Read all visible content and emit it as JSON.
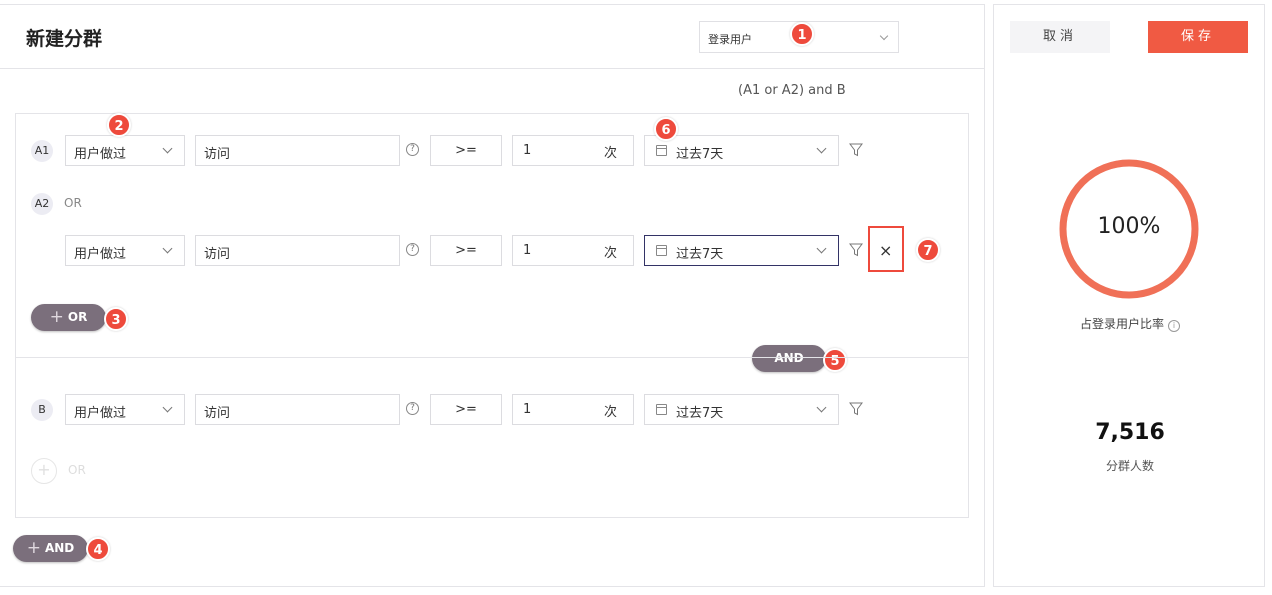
{
  "header": {
    "title": "新建分群",
    "user_type_select": "登录用户",
    "formula": "(A1 or A2) and B"
  },
  "rows": {
    "a1": {
      "badge": "A1",
      "action": "用户做过",
      "event": "访问",
      "operator": ">=",
      "count": "1",
      "unit": "次",
      "date_range": "过去7天"
    },
    "a2": {
      "badge": "A2",
      "connector": "OR",
      "action": "用户做过",
      "event": "访问",
      "operator": ">=",
      "count": "1",
      "unit": "次",
      "date_range": "过去7天"
    },
    "b": {
      "badge": "B",
      "action": "用户做过",
      "event": "访问",
      "operator": ">=",
      "count": "1",
      "unit": "次",
      "date_range": "过去7天"
    }
  },
  "buttons": {
    "add_or": "OR",
    "and_connector": "AND",
    "add_or_disabled": "OR",
    "add_and": "AND",
    "cancel": "取消",
    "save": "保存"
  },
  "icons": {
    "help": "?",
    "plus": "+",
    "delete": "×",
    "info": "i"
  },
  "markers": [
    "1",
    "2",
    "3",
    "4",
    "5",
    "6",
    "7"
  ],
  "summary": {
    "percentage_text": "100%",
    "percentage_value": 1.0,
    "ratio_label": "占登录用户比率",
    "count": "7,516",
    "count_label": "分群人数"
  },
  "colors": {
    "accent": "#f05a43",
    "pill": "#7b6f7c",
    "marker": "#ee4a3c",
    "ring": "#f07057"
  }
}
